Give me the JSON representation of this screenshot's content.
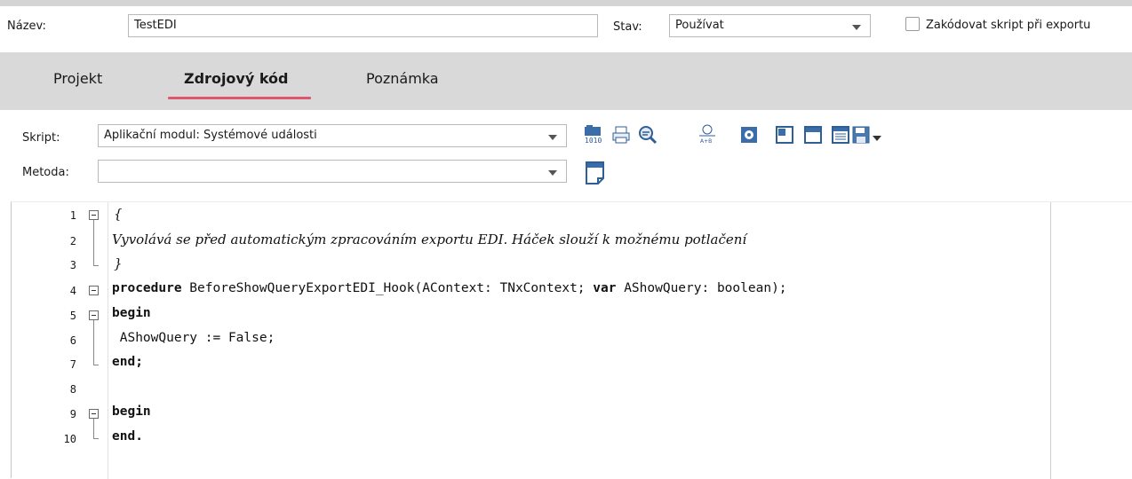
{
  "header": {
    "name_label": "Název:",
    "name_value": "TestEDI",
    "status_label": "Stav:",
    "status_value": "Používat",
    "encode_label": "Zakódovat skript při exportu"
  },
  "tabs": [
    {
      "label": "Projekt"
    },
    {
      "label": "Zdrojový kód"
    },
    {
      "label": "Poznámka"
    }
  ],
  "script": {
    "script_label": "Skript:",
    "script_value": "Aplikační modul: Systémové události",
    "method_label": "Metoda:",
    "method_value": ""
  },
  "toolbar_icons": [
    "compile-icon",
    "print-icon",
    "find-icon",
    "compare-icon",
    "settings-icon",
    "template-icon",
    "snippet-icon",
    "document-list-icon",
    "save-icon",
    "dropdown-arrow-icon"
  ],
  "editor": {
    "lines": [
      {
        "num": "1",
        "text": "{"
      },
      {
        "num": "2",
        "text": "Vyvolává se před automatickým zpracováním exportu EDI. Háček slouží k možnému potlačení"
      },
      {
        "num": "3",
        "text": "}"
      },
      {
        "num": "4",
        "kw1": "procedure",
        "text": " BeforeShowQueryExportEDI_Hook(AContext: TNxContext; ",
        "kw2": "var",
        "text2": " AShowQuery: boolean);"
      },
      {
        "num": "5",
        "kw1": "begin"
      },
      {
        "num": "6",
        "text": " AShowQuery := False;"
      },
      {
        "num": "7",
        "kw1": "end;"
      },
      {
        "num": "8",
        "text": ""
      },
      {
        "num": "9",
        "kw1": "begin"
      },
      {
        "num": "10",
        "kw1": "end."
      }
    ]
  }
}
